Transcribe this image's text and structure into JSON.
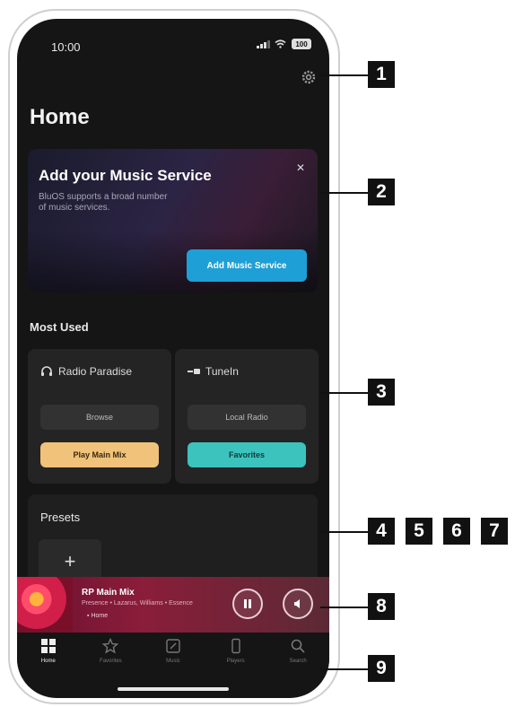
{
  "status": {
    "time": "10:00",
    "battery": "100"
  },
  "header": {
    "title": "Home"
  },
  "promo": {
    "title": "Add your Music Service",
    "description": "BluOS supports a broad number of music services.",
    "button_label": "Add Music Service"
  },
  "most_used": {
    "title": "Most Used",
    "cards": [
      {
        "name": "Radio Paradise",
        "browse_label": "Browse",
        "action_label": "Play Main Mix"
      },
      {
        "name": "TuneIn",
        "browse_label": "Local Radio",
        "action_label": "Favorites"
      }
    ]
  },
  "presets": {
    "title": "Presets",
    "add_label": "+"
  },
  "now_playing": {
    "title": "RP Main Mix",
    "subtitle": "Presence • Lazarus, Williams • Essence",
    "room": "Home",
    "accent": "#8a1d3a"
  },
  "tabs": [
    {
      "label": "Home"
    },
    {
      "label": "Favorites"
    },
    {
      "label": "Music"
    },
    {
      "label": "Players"
    },
    {
      "label": "Search"
    }
  ],
  "callouts": [
    "1",
    "2",
    "3",
    "4",
    "5",
    "6",
    "7",
    "8",
    "9"
  ],
  "colors": {
    "promo_button": "#1e9fd6",
    "play_main_mix": "#f0c27a",
    "favorites": "#3cc3bd"
  }
}
